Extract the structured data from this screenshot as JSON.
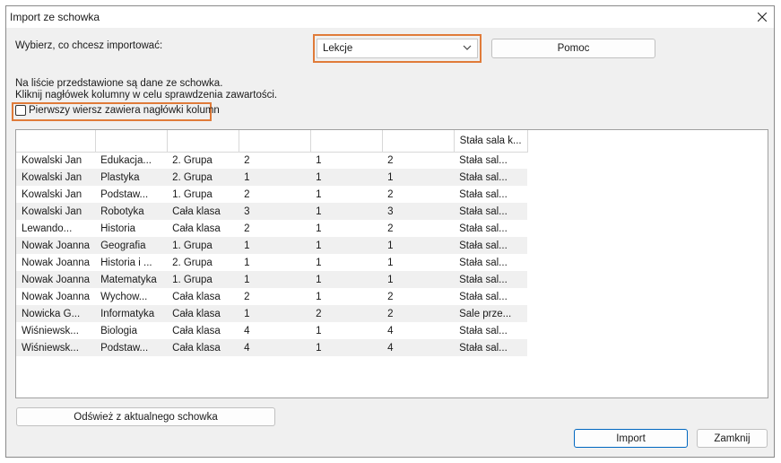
{
  "window": {
    "title": "Import ze schowka"
  },
  "form": {
    "choose_label": "Wybierz, co chcesz importować:",
    "select_value": "Lekcje",
    "help_button": "Pomoc",
    "info_line1": "Na liście przedstawione są dane ze schowka.",
    "info_line2": "Kliknij nagłówek kolumny w celu sprawdzenia zawartości.",
    "header_checkbox_label": "Pierwszy wiersz zawiera nagłówki kolumn"
  },
  "table": {
    "headers": [
      "",
      "",
      "",
      "",
      "",
      "",
      "Stała sala k..."
    ],
    "rows": [
      [
        "Kowalski Jan",
        "Edukacja...",
        "2. Grupa",
        "2",
        "1",
        "2",
        "Stała sal..."
      ],
      [
        "Kowalski Jan",
        "Plastyka",
        "2. Grupa",
        "1",
        "1",
        "1",
        "Stała sal..."
      ],
      [
        "Kowalski Jan",
        "Podstaw...",
        "1. Grupa",
        "2",
        "1",
        "2",
        "Stała sal..."
      ],
      [
        "Kowalski Jan",
        "Robotyka",
        "Cała klasa",
        "3",
        "1",
        "3",
        "Stała sal..."
      ],
      [
        "Lewando...",
        "Historia",
        "Cała klasa",
        "2",
        "1",
        "2",
        "Stała sal..."
      ],
      [
        "Nowak Joanna",
        "Geografia",
        "1. Grupa",
        "1",
        "1",
        "1",
        "Stała sal..."
      ],
      [
        "Nowak Joanna",
        "Historia i ...",
        "2. Grupa",
        "1",
        "1",
        "1",
        "Stała sal..."
      ],
      [
        "Nowak Joanna",
        "Matematyka",
        "1. Grupa",
        "1",
        "1",
        "1",
        "Stała sal..."
      ],
      [
        "Nowak Joanna",
        "Wychow...",
        "Cała klasa",
        "2",
        "1",
        "2",
        "Stała sal..."
      ],
      [
        "Nowicka G...",
        "Informatyka",
        "Cała klasa",
        "1",
        "2",
        "2",
        "Sale prze..."
      ],
      [
        "Wiśniewsk...",
        "Biologia",
        "Cała klasa",
        "4",
        "1",
        "4",
        "Stała sal..."
      ],
      [
        "Wiśniewsk...",
        "Podstaw...",
        "Cała klasa",
        "4",
        "1",
        "4",
        "Stała sal..."
      ]
    ]
  },
  "footer": {
    "refresh_button": "Odśwież z aktualnego schowka",
    "import_button": "Import",
    "close_button": "Zamknij"
  },
  "colors": {
    "highlight": "#e07b39",
    "primary_border": "#0067c0"
  }
}
